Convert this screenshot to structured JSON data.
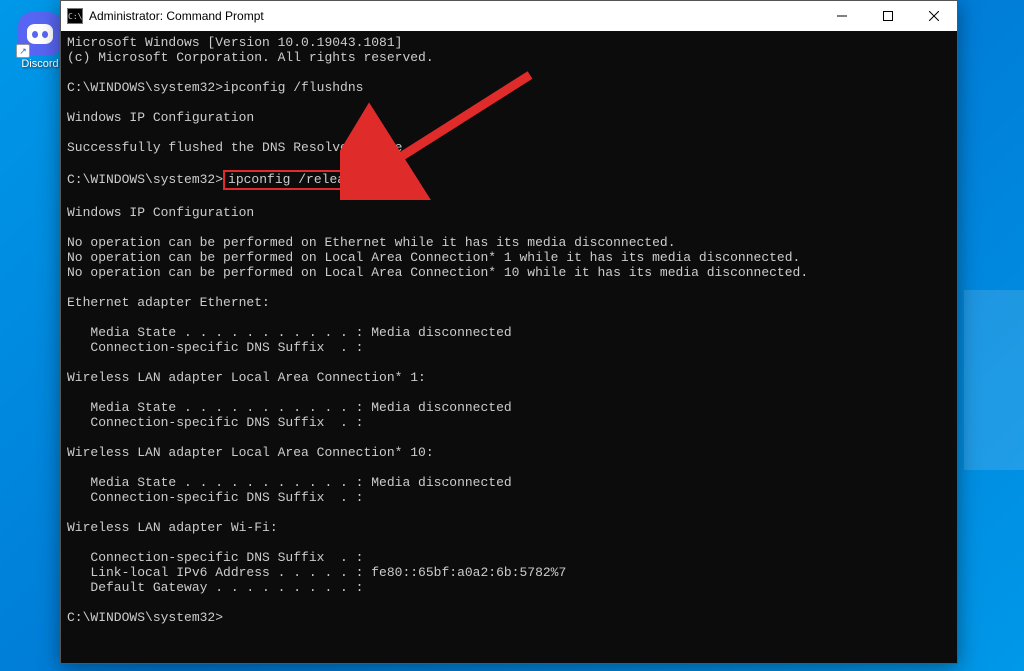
{
  "desktop": {
    "discord_label": "Discord"
  },
  "window": {
    "title": "Administrator: Command Prompt",
    "icon_text": "C:\\"
  },
  "terminal": {
    "line1": "Microsoft Windows [Version 10.0.19043.1081]",
    "line2": "(c) Microsoft Corporation. All rights reserved.",
    "blank": "",
    "prompt1_path": "C:\\WINDOWS\\system32>",
    "prompt1_cmd": "ipconfig /flushdns",
    "ipcfg_hdr": "Windows IP Configuration",
    "flush_ok": "Successfully flushed the DNS Resolver Cache.",
    "prompt2_path": "C:\\WINDOWS\\system32>",
    "prompt2_cmd": "ipconfig /release",
    "noop_eth": "No operation can be performed on Ethernet while it has its media disconnected.",
    "noop_lac1": "No operation can be performed on Local Area Connection* 1 while it has its media disconnected.",
    "noop_lac10": "No operation can be performed on Local Area Connection* 10 while it has its media disconnected.",
    "eth_hdr": "Ethernet adapter Ethernet:",
    "media_state": "   Media State . . . . . . . . . . . : Media disconnected",
    "dns_suffix": "   Connection-specific DNS Suffix  . :",
    "wlan1_hdr": "Wireless LAN adapter Local Area Connection* 1:",
    "wlan10_hdr": "Wireless LAN adapter Local Area Connection* 10:",
    "wifi_hdr": "Wireless LAN adapter Wi-Fi:",
    "link_local": "   Link-local IPv6 Address . . . . . : fe80::65bf:a0a2:6b:5782%7",
    "gateway": "   Default Gateway . . . . . . . . . :",
    "prompt3_path": "C:\\WINDOWS\\system32>"
  }
}
